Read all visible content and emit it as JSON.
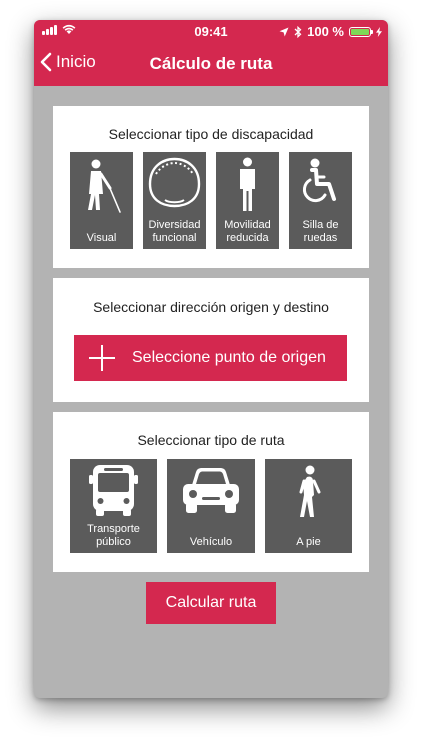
{
  "status_bar": {
    "time": "09:41",
    "battery_text": "100 %",
    "battery_level": 1.0,
    "signal_bars": 4
  },
  "nav": {
    "back_label": "Inicio",
    "title": "Cálculo de ruta"
  },
  "disability_section": {
    "title": "Seleccionar tipo de discapacidad",
    "items": [
      {
        "label": "Visual",
        "icon": "blind-person-cane-icon"
      },
      {
        "label": "Diversidad funcional",
        "icon": "head-icon"
      },
      {
        "label": "Movilidad reducida",
        "icon": "standing-person-icon"
      },
      {
        "label": "Silla de ruedas",
        "icon": "wheelchair-icon"
      }
    ]
  },
  "address_section": {
    "title": "Seleccionar dirección origen y destino",
    "origin_button_label": "Seleccione punto de origen",
    "origin_button_icon": "plus-icon"
  },
  "route_section": {
    "title": "Seleccionar tipo de ruta",
    "items": [
      {
        "label": "Transporte público",
        "icon": "bus-icon"
      },
      {
        "label": "Vehículo",
        "icon": "car-icon"
      },
      {
        "label": "A pie",
        "icon": "walking-person-icon"
      }
    ]
  },
  "calculate_button_label": "Calcular ruta",
  "colors": {
    "brand": "#d4284f",
    "tile": "#5b5b5b",
    "background": "#b3b3b3",
    "card": "#ffffff"
  }
}
